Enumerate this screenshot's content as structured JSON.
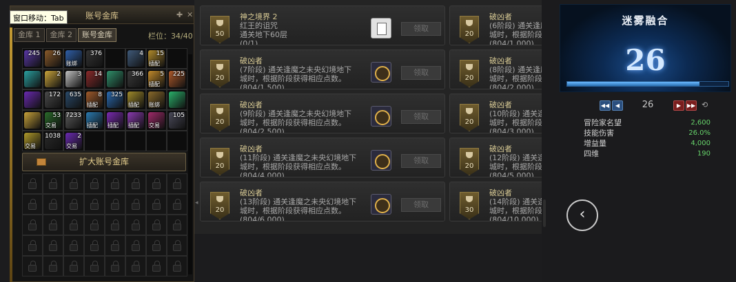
{
  "storage": {
    "title": "账号金库",
    "hint": "窗口移动：Tab",
    "tabs": [
      "金库 1",
      "金库 2",
      "账号金库"
    ],
    "slots": "栏位：34/40",
    "expand_label": "扩大账号金库",
    "items": [
      {
        "count": "245",
        "tag": "",
        "color": "#5a38a8"
      },
      {
        "count": "26",
        "tag": "",
        "color": "#8a5a2a"
      },
      {
        "count": "",
        "tag": "账绑",
        "color": "#2f5fa8"
      },
      {
        "count": "376",
        "tag": "",
        "color": "#333"
      },
      {
        "count": "",
        "tag": "",
        "color": "#0d0d0d"
      },
      {
        "count": "4",
        "tag": "",
        "color": "#3f5a7a"
      },
      {
        "count": "15",
        "tag": "插配",
        "color": "#b08a2a"
      },
      {
        "count": "",
        "tag": "",
        "color": "#0d0d0d"
      },
      {
        "count": "",
        "tag": "",
        "color": "#2aa0a0"
      },
      {
        "count": "2",
        "tag": "",
        "color": "#c8a33a"
      },
      {
        "count": "3",
        "tag": "",
        "color": "#c0c0c0"
      },
      {
        "count": "14",
        "tag": "",
        "color": "#8a2a2a"
      },
      {
        "count": "",
        "tag": "",
        "color": "#2f8f6a"
      },
      {
        "count": "366",
        "tag": "",
        "color": "#3a3a3a"
      },
      {
        "count": "5",
        "tag": "插配",
        "color": "#c28a2a"
      },
      {
        "count": "225",
        "tag": "",
        "color": "#b05a2a"
      },
      {
        "count": "",
        "tag": "",
        "color": "#6a2ab0"
      },
      {
        "count": "172",
        "tag": "",
        "color": "#4a4a4a"
      },
      {
        "count": "635",
        "tag": "",
        "color": "#2a4a6a"
      },
      {
        "count": "8",
        "tag": "插配",
        "color": "#a05a2a"
      },
      {
        "count": "325",
        "tag": "",
        "color": "#2a6ab0"
      },
      {
        "count": "",
        "tag": "插配",
        "color": "#a08a2a"
      },
      {
        "count": "",
        "tag": "账绑",
        "color": "#8a6a2a"
      },
      {
        "count": "",
        "tag": "",
        "color": "#2ab06a"
      },
      {
        "count": "",
        "tag": "",
        "color": "#c8a23a"
      },
      {
        "count": "53",
        "tag": "交易",
        "color": "#2a6a2a"
      },
      {
        "count": "7233",
        "tag": "",
        "color": "#5a5a5a"
      },
      {
        "count": "",
        "tag": "插配",
        "color": "#2a7ab0"
      },
      {
        "count": "",
        "tag": "插配",
        "color": "#7a2ab0"
      },
      {
        "count": "",
        "tag": "插配",
        "color": "#8a3ab0"
      },
      {
        "count": "",
        "tag": "交易",
        "color": "#a02a6a"
      },
      {
        "count": "105",
        "tag": "",
        "color": "#4a4a5a"
      },
      {
        "count": "",
        "tag": "交易",
        "color": "#b09a2a"
      },
      {
        "count": "1038",
        "tag": "",
        "color": "#2a2a2a"
      },
      {
        "count": "2",
        "tag": "交易",
        "color": "#6a2ab0"
      },
      {
        "count": "",
        "tag": "",
        "color": "#0d0d0d"
      },
      {
        "count": "",
        "tag": "",
        "color": "#0d0d0d"
      },
      {
        "count": "",
        "tag": "",
        "color": "#0d0d0d"
      },
      {
        "count": "",
        "tag": "",
        "color": "#0d0d0d"
      },
      {
        "count": "",
        "tag": "",
        "color": "#0d0d0d"
      }
    ]
  },
  "achievements": {
    "claim_label": "领取",
    "cards": [
      {
        "title": "神之境界 2",
        "line2": "红王的诅咒",
        "line3": "通关地下60层",
        "progress": "(0/1)",
        "badge": "50",
        "icon": "doc"
      },
      {
        "title": "破凶者",
        "line2": "(6阶段) 通关逢魔",
        "line3": "城时，根据阶段",
        "progress": "(804/1,000)",
        "badge": "20",
        "icon": "gold"
      },
      {
        "title": "破凶者",
        "line2": "(7阶段) 通关逢魔之未央幻境地下",
        "line3": "城时，根据阶段获得相应点数。",
        "progress": "(804/1,500)",
        "badge": "20",
        "icon": "gold"
      },
      {
        "title": "破凶者",
        "line2": "(8阶段) 通关逢魔",
        "line3": "城时，根据阶段",
        "progress": "(804/2,000)",
        "badge": "20",
        "icon": "gold"
      },
      {
        "title": "破凶者",
        "line2": "(9阶段) 通关逢魔之未央幻境地下",
        "line3": "城时，根据阶段获得相应点数。",
        "progress": "(804/2,500)",
        "badge": "20",
        "icon": "gold"
      },
      {
        "title": "破凶者",
        "line2": "(10阶段) 通关逢",
        "line3": "城时，根据阶段",
        "progress": "(804/3,000)",
        "badge": "20",
        "icon": "gold"
      },
      {
        "title": "破凶者",
        "line2": "(11阶段) 通关逢魔之未央幻境地下",
        "line3": "城时，根据阶段获得相应点数。",
        "progress": "(804/4,000)",
        "badge": "20",
        "icon": "gold"
      },
      {
        "title": "破凶者",
        "line2": "(12阶段) 通关逢",
        "line3": "城时，根据阶段",
        "progress": "(804/5,000)",
        "badge": "20",
        "icon": "gold"
      },
      {
        "title": "破凶者",
        "line2": "(13阶段) 通关逢魔之未央幻境地下",
        "line3": "城时，根据阶段获得相应点数。",
        "progress": "(804/6,000)",
        "badge": "20",
        "icon": "gold"
      },
      {
        "title": "破凶者",
        "line2": "(14阶段) 通关逢",
        "line3": "城时，根据阶段",
        "progress": "(804/10,000)",
        "badge": "30",
        "icon": "gold"
      }
    ]
  },
  "fusion": {
    "title": "迷雾融合",
    "level": "26",
    "level_input": "26",
    "progress_fraction": 0.82,
    "stats": [
      {
        "name": "冒险家名望",
        "value": "2,600"
      },
      {
        "name": "技能伤害",
        "value": "26.0%"
      },
      {
        "name": "增益量",
        "value": "4,000"
      },
      {
        "name": "四维",
        "value": "190"
      }
    ],
    "back_icon": "chevron-left-icon"
  }
}
